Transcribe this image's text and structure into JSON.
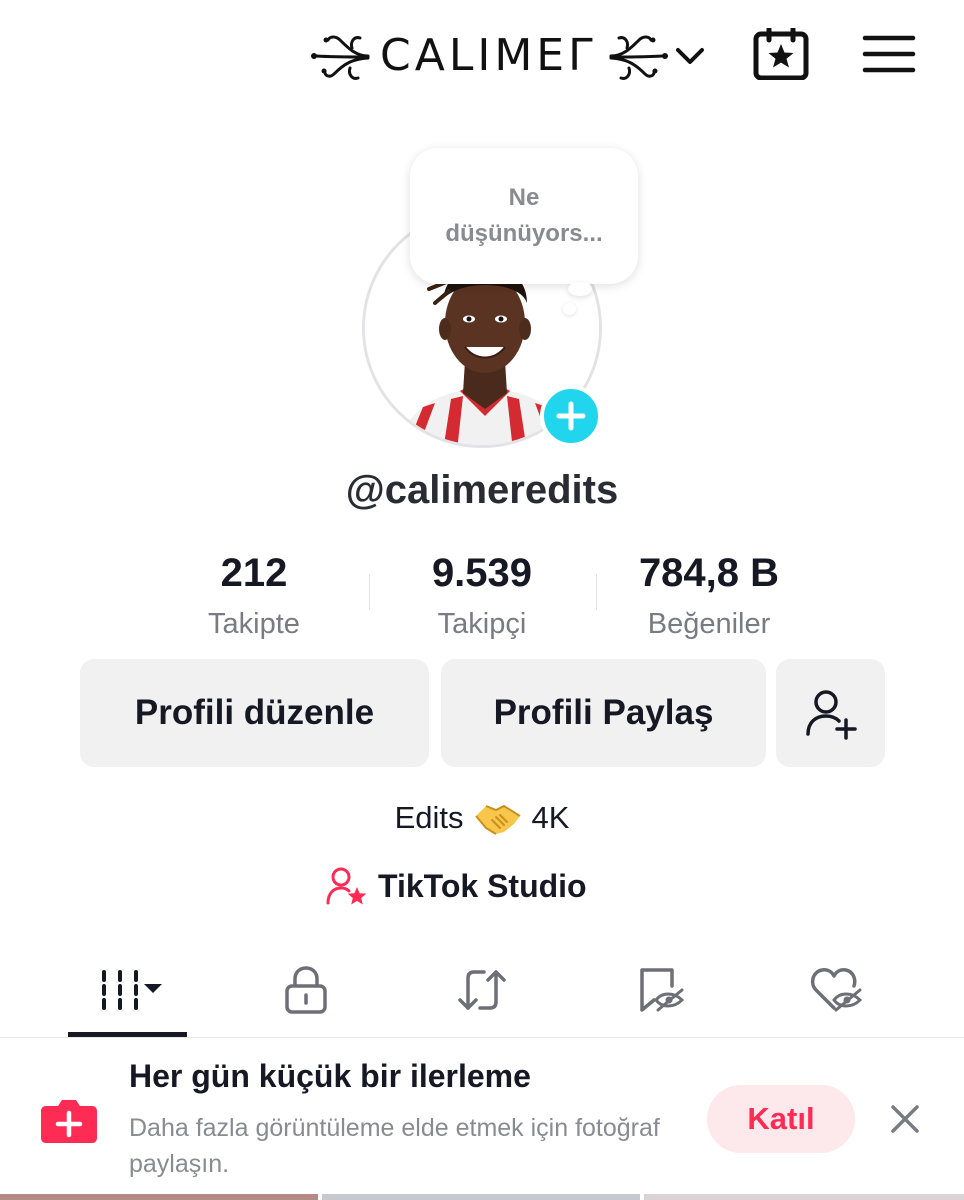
{
  "header": {
    "brand_name": "CALIMEГ",
    "brand_switch_icon": "chevron-down-icon",
    "calendar_icon": "calendar-star-icon",
    "menu_icon": "hamburger-menu-icon"
  },
  "profile": {
    "thought_prompt": "Ne düşünüyors...",
    "username": "@calimeredits",
    "add_photo_icon": "plus-icon"
  },
  "stats": [
    {
      "value": "212",
      "label": "Takipte"
    },
    {
      "value": "9.539",
      "label": "Takipçi"
    },
    {
      "value": "784,8 B",
      "label": "Beğeniler"
    }
  ],
  "actions": {
    "edit_label": "Profili düzenle",
    "share_label": "Profili Paylaş",
    "add_friend_icon": "add-user-icon"
  },
  "bio": {
    "text_before": "Edits",
    "emoji_icon": "handshake-emoji-icon",
    "text_after": "4K"
  },
  "studio": {
    "label": "TikTok Studio",
    "icon": "user-star-icon"
  },
  "tabs": [
    {
      "name": "videos",
      "icon": "grid-bars-icon",
      "active": true
    },
    {
      "name": "private",
      "icon": "lock-icon",
      "active": false
    },
    {
      "name": "reposts",
      "icon": "repost-icon",
      "active": false
    },
    {
      "name": "favorites",
      "icon": "bookmark-hidden-icon",
      "active": false
    },
    {
      "name": "liked",
      "icon": "heart-hidden-icon",
      "active": false
    }
  ],
  "promo": {
    "title": "Her gün küçük bir ilerleme",
    "subtitle": "Daha fazla görüntüleme elde etmek için fotoğraf paylaşın.",
    "join_label": "Katıl",
    "close_icon": "close-icon"
  },
  "colors": {
    "accent_red": "#fe2c55",
    "avatar_add": "#20d5ec",
    "text_primary": "#161823",
    "text_secondary": "#7a7b82",
    "button_bg": "#f1f1f2"
  }
}
